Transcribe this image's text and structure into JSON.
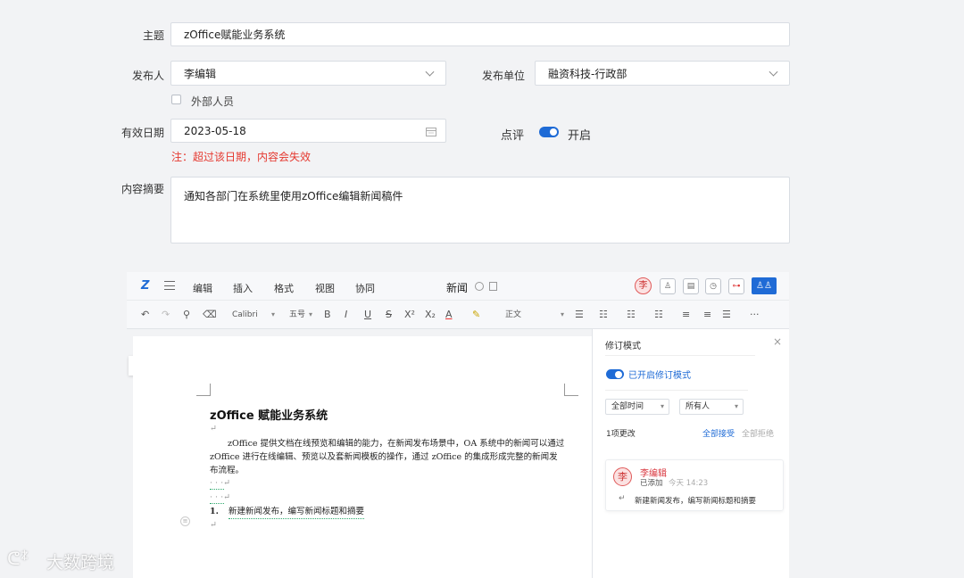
{
  "form": {
    "subject_label": "主题",
    "subject_value": "zOffice赋能业务系统",
    "publisher_label": "发布人",
    "publisher_value": "李编辑",
    "unit_label": "发布单位",
    "unit_value": "融资科技-行政部",
    "external_label": "外部人员",
    "date_label": "有效日期",
    "date_value": "2023-05-18",
    "comment_label": "点评",
    "comment_state": "开启",
    "note": "注：超过该日期，内容会失效",
    "summary_label": "内容摘要",
    "summary_value": "通知各部门在系统里使用zOffice编辑新闻稿件"
  },
  "editor": {
    "logo": "Z",
    "menu": [
      "编辑",
      "插入",
      "格式",
      "视图",
      "协同"
    ],
    "doc_name": "新闻",
    "user_avatar": "李",
    "toolbar": {
      "font": "Calibri",
      "size": "五号",
      "style": "正文",
      "bold": "B",
      "italic": "I",
      "underline": "U",
      "strike": "S",
      "superscript": "X²",
      "subscript": "X₂",
      "font_color": "A",
      "more": "···"
    },
    "document": {
      "title": "zOffice 赋能业务系统",
      "paragraph": "zOffice 提供文档在线预览和编辑的能力，在新闻发布场景中，OA 系统中的新闻可以通过 zOffice 进行在线编辑、预览以及套新闻模板的操作，通过 zOffice 的集成形成完整的新闻发布流程。",
      "list_number": "1.",
      "list_item": "新建新闻发布，编写新闻标题和摘要"
    },
    "revision": {
      "title": "修订模式",
      "enabled_label": "已开启修订模式",
      "time_filter": "全部时间",
      "person_filter": "所有人",
      "count": "1项更改",
      "accept_all": "全部接受",
      "reject_all": "全部拒绝",
      "author_avatar": "李",
      "author": "李编辑",
      "action": "已添加",
      "time": "今天 14:23",
      "change_text": "新建新闻发布，编写新闻标题和摘要"
    }
  },
  "watermark": "大数跨境",
  "colors": {
    "accent": "#1f6bd6",
    "warning": "#e5382f",
    "author": "#d9363e"
  }
}
